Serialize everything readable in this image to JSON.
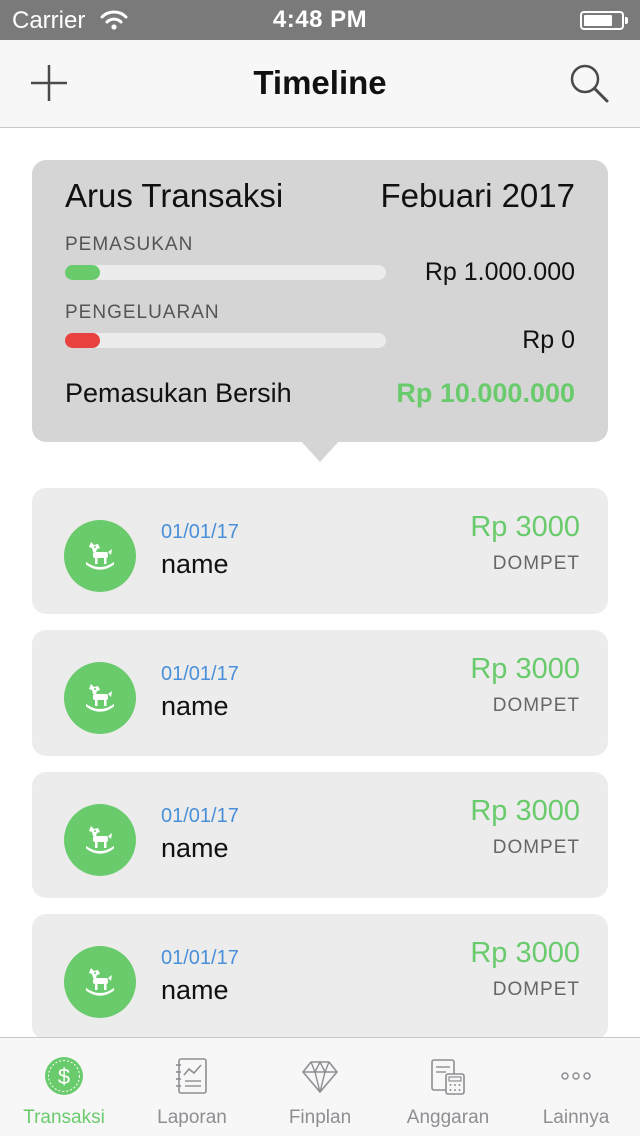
{
  "status_bar": {
    "carrier": "Carrier",
    "time": "4:48 PM"
  },
  "nav": {
    "title": "Timeline",
    "add_icon": "plus-icon",
    "search_icon": "search-icon"
  },
  "summary": {
    "title": "Arus Transaksi",
    "period": "Febuari 2017",
    "income": {
      "label": "PEMASUKAN",
      "amount": "Rp 1.000.000",
      "progress": 0.11,
      "color": "#6acb6d"
    },
    "expense": {
      "label": "PENGELUARAN",
      "amount": "Rp 0",
      "progress": 0.11,
      "color": "#e8413e"
    },
    "net_label": "Pemasukan Bersih",
    "net_value": "Rp 10.000.000"
  },
  "transactions": [
    {
      "date": "01/01/17",
      "name": "name",
      "amount": "Rp 3000",
      "wallet": "DOMPET",
      "icon": "rocking-horse-icon"
    },
    {
      "date": "01/01/17",
      "name": "name",
      "amount": "Rp 3000",
      "wallet": "DOMPET",
      "icon": "rocking-horse-icon"
    },
    {
      "date": "01/01/17",
      "name": "name",
      "amount": "Rp 3000",
      "wallet": "DOMPET",
      "icon": "rocking-horse-icon"
    },
    {
      "date": "01/01/17",
      "name": "name",
      "amount": "Rp 3000",
      "wallet": "DOMPET",
      "icon": "rocking-horse-icon"
    }
  ],
  "tabs": [
    {
      "label": "Transaksi",
      "icon": "dollar-coin-icon",
      "active": true
    },
    {
      "label": "Laporan",
      "icon": "report-notebook-icon",
      "active": false
    },
    {
      "label": "Finplan",
      "icon": "diamond-icon",
      "active": false
    },
    {
      "label": "Anggaran",
      "icon": "calculator-icon",
      "active": false
    },
    {
      "label": "Lainnya",
      "icon": "more-dots-icon",
      "active": false
    }
  ],
  "colors": {
    "accent_green": "#6acb6d",
    "expense_red": "#e8413e",
    "date_blue": "#4a90d9",
    "status_bar": "#7a7a7a"
  }
}
